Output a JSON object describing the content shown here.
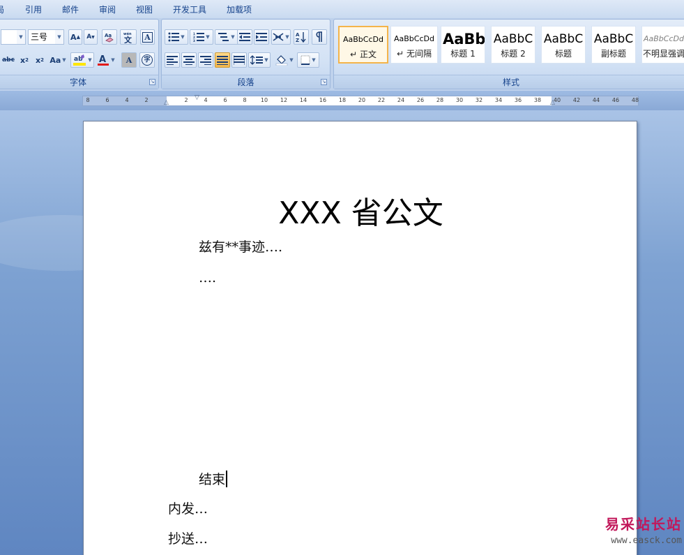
{
  "menu": {
    "tabs": [
      "局",
      "引用",
      "邮件",
      "审阅",
      "视图",
      "开发工具",
      "加载项"
    ]
  },
  "font_group": {
    "label": "字体",
    "size_value": "三号",
    "buttons": {
      "grow_font": "A",
      "shrink_font": "A",
      "strikethrough": "abc",
      "subscript": "x",
      "superscript": "x",
      "change_case": "Aa",
      "font_color": "A",
      "char_shading": "A",
      "enclose_char": "字",
      "phonetic": "文",
      "char_border": "A"
    }
  },
  "paragraph_group": {
    "label": "段落"
  },
  "styles_group": {
    "label": "样式",
    "items": [
      {
        "sample": "AaBbCcDd",
        "name": "正文",
        "prefix": "↵",
        "selected": true
      },
      {
        "sample": "AaBbCcDd",
        "name": "无间隔",
        "prefix": "↵"
      },
      {
        "sample": "AaBb",
        "name": "标题 1"
      },
      {
        "sample": "AaBbC",
        "name": "标题 2"
      },
      {
        "sample": "AaBbC",
        "name": "标题"
      },
      {
        "sample": "AaBbC",
        "name": "副标题"
      },
      {
        "sample": "AaBbCcDd",
        "name": "不明显强调"
      }
    ]
  },
  "ruler": {
    "left_labels": [
      "8",
      "6",
      "4",
      "2"
    ],
    "right_labels": [
      "2",
      "4",
      "6",
      "8",
      "10",
      "12",
      "14",
      "16",
      "18",
      "20",
      "22",
      "24",
      "26",
      "28",
      "30",
      "32",
      "34",
      "36",
      "38",
      "40",
      "42",
      "44",
      "46",
      "48"
    ]
  },
  "document": {
    "title": "XXX 省公文",
    "lines": [
      "兹有**事迹….",
      "….",
      "结束",
      "内发…",
      "抄送…"
    ]
  },
  "watermark": {
    "chinese": "易采站长站",
    "url": "www.easck.com"
  },
  "colors": {
    "ribbon_text": "#15428b",
    "selected_style_border": "#f4b44a",
    "font_color_bar": "#e11b1b",
    "highlight_bar": "#ffe600",
    "watermark": "#c2185b"
  }
}
